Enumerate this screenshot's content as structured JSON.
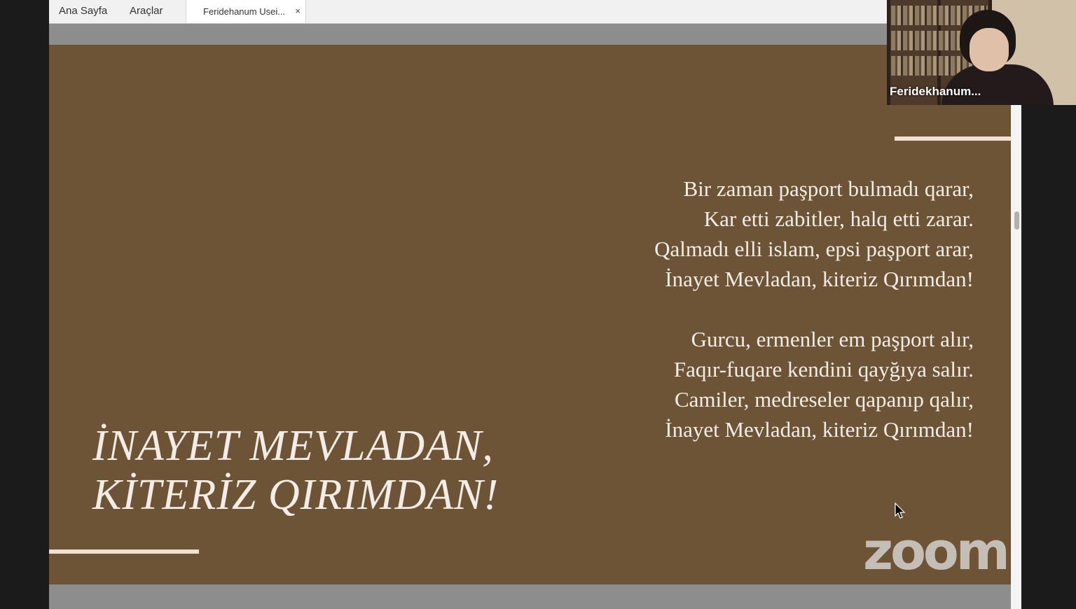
{
  "toolbar": {
    "menu": [
      "Ana Sayfa",
      "Araçlar"
    ],
    "tab": {
      "label": "Feridehanum Usei...",
      "close": "×"
    }
  },
  "slide": {
    "title_lines": [
      "İNAYET MEVLADAN,",
      "KİTERİZ QIRIMDAN!"
    ],
    "stanzas": [
      [
        "Bir zaman paşport bulmadı qarar,",
        "Kar etti zabitler, halq etti zarar.",
        "Qalmadı elli islam, epsi paşport arar,",
        "İnayet Mevladan, kiteriz Qırımdan!"
      ],
      [
        "Gurcu, ermenler em paşport alır,",
        "Faqır-fuqare kendini qayğıya salır.",
        "Camiler, medreseler qapanıp qalır,",
        "İnayet Mevladan, kiteriz Qırımdan!"
      ]
    ]
  },
  "video": {
    "participant_name": "Feridekhanum..."
  },
  "watermark": "zoom",
  "colors": {
    "slide_background": "#6e5437",
    "slide_text": "#f4ece6",
    "accent_rule": "#f2e0d2"
  }
}
